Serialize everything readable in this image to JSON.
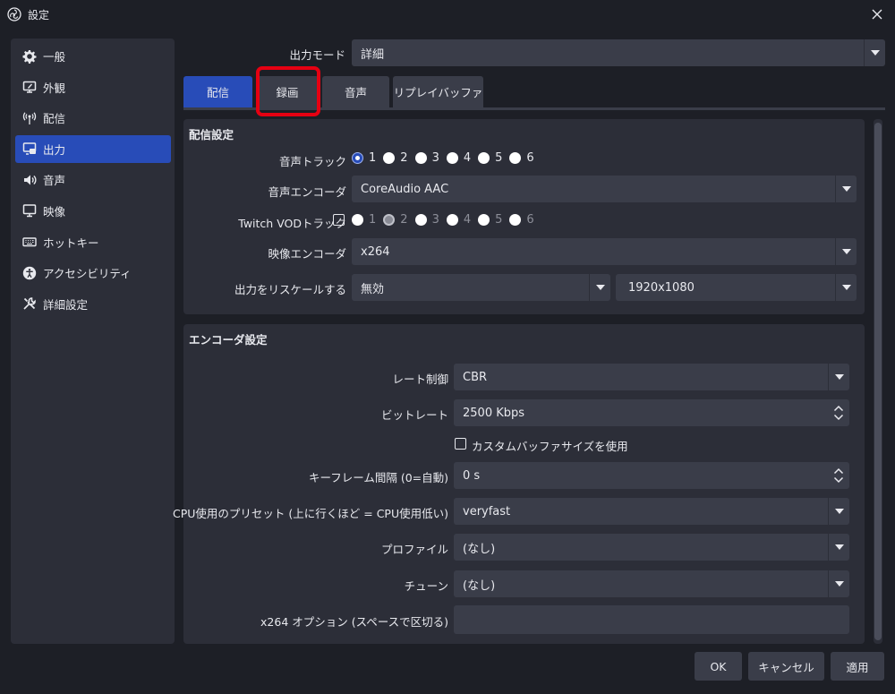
{
  "window": {
    "title": "設定"
  },
  "sidebar": {
    "items": [
      {
        "label": "一般",
        "icon": "gear-icon"
      },
      {
        "label": "外観",
        "icon": "appearance-icon"
      },
      {
        "label": "配信",
        "icon": "broadcast-icon"
      },
      {
        "label": "出力",
        "icon": "output-icon",
        "active": true
      },
      {
        "label": "音声",
        "icon": "speaker-icon"
      },
      {
        "label": "映像",
        "icon": "monitor-icon"
      },
      {
        "label": "ホットキー",
        "icon": "keyboard-icon"
      },
      {
        "label": "アクセシビリティ",
        "icon": "accessibility-icon"
      },
      {
        "label": "詳細設定",
        "icon": "tools-icon"
      }
    ]
  },
  "output_mode": {
    "label": "出力モード",
    "value": "詳細"
  },
  "tabs": [
    {
      "label": "配信",
      "active": true
    },
    {
      "label": "録画",
      "highlighted": true
    },
    {
      "label": "音声"
    },
    {
      "label": "リプレイバッファ"
    }
  ],
  "stream_settings": {
    "title": "配信設定",
    "audio_track": {
      "label": "音声トラック",
      "options": [
        "1",
        "2",
        "3",
        "4",
        "5",
        "6"
      ],
      "selected": "1"
    },
    "audio_encoder": {
      "label": "音声エンコーダ",
      "value": "CoreAudio AAC"
    },
    "twitch_vod": {
      "label": "Twitch VODトラック",
      "options": [
        "1",
        "2",
        "3",
        "4",
        "5",
        "6"
      ],
      "selected": "2"
    },
    "video_encoder": {
      "label": "映像エンコーダ",
      "value": "x264"
    },
    "rescale": {
      "label": "出力をリスケールする",
      "value": "無効",
      "resolution": "1920x1080"
    }
  },
  "encoder_settings": {
    "title": "エンコーダ設定",
    "rate_control": {
      "label": "レート制御",
      "value": "CBR"
    },
    "bitrate": {
      "label": "ビットレート",
      "value": "2500 Kbps"
    },
    "custom_buffer": {
      "label": "カスタムバッファサイズを使用"
    },
    "keyframe": {
      "label": "キーフレーム間隔 (0=自動)",
      "value": "0 s"
    },
    "cpu_preset": {
      "label": "CPU使用のプリセット (上に行くほど = CPU使用低い)",
      "value": "veryfast"
    },
    "profile": {
      "label": "プロファイル",
      "value": "(なし)"
    },
    "tune": {
      "label": "チューン",
      "value": "(なし)"
    },
    "x264_options": {
      "label": "x264 オプション (スペースで区切る)",
      "value": ""
    }
  },
  "buttons": {
    "ok": "OK",
    "cancel": "キャンセル",
    "apply": "適用"
  },
  "colors": {
    "accent": "#284cb8",
    "highlight": "#e60012",
    "panel": "#2c2e38",
    "background": "#1d1f26"
  }
}
